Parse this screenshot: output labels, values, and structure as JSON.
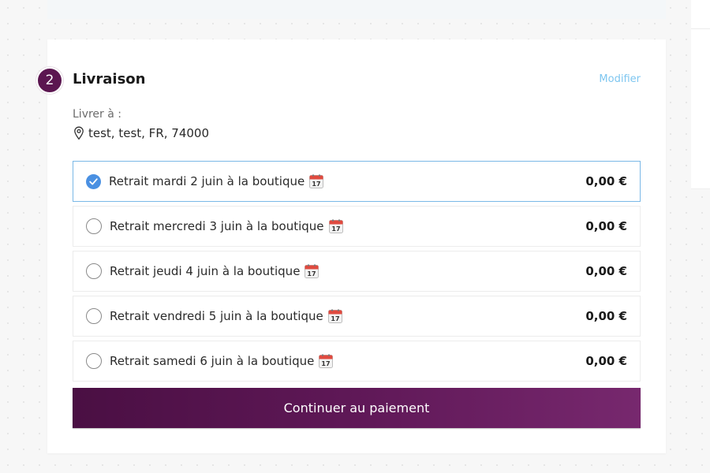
{
  "step": {
    "number": "2",
    "title": "Livraison",
    "edit_label": "Modifier"
  },
  "delivery": {
    "label": "Livrer à :",
    "address": "test, test, FR, 74000",
    "address_icon": "map-pin-icon"
  },
  "options": [
    {
      "label": "Retrait mardi 2 juin à la boutique",
      "price": "0,00 €",
      "selected": true,
      "icon": "calendar-icon"
    },
    {
      "label": "Retrait mercredi 3 juin à la boutique",
      "price": "0,00 €",
      "selected": false,
      "icon": "calendar-icon"
    },
    {
      "label": "Retrait jeudi 4 juin à la boutique",
      "price": "0,00 €",
      "selected": false,
      "icon": "calendar-icon"
    },
    {
      "label": "Retrait vendredi 5 juin à la boutique",
      "price": "0,00 €",
      "selected": false,
      "icon": "calendar-icon"
    },
    {
      "label": "Retrait samedi 6 juin à la boutique",
      "price": "0,00 €",
      "selected": false,
      "icon": "calendar-icon"
    }
  ],
  "continue_label": "Continuer au paiement",
  "colors": {
    "brand": "#5b1650",
    "link": "#7ec6f0",
    "selected_border": "#7ab8e6",
    "radio_checked": "#4a90e2"
  }
}
